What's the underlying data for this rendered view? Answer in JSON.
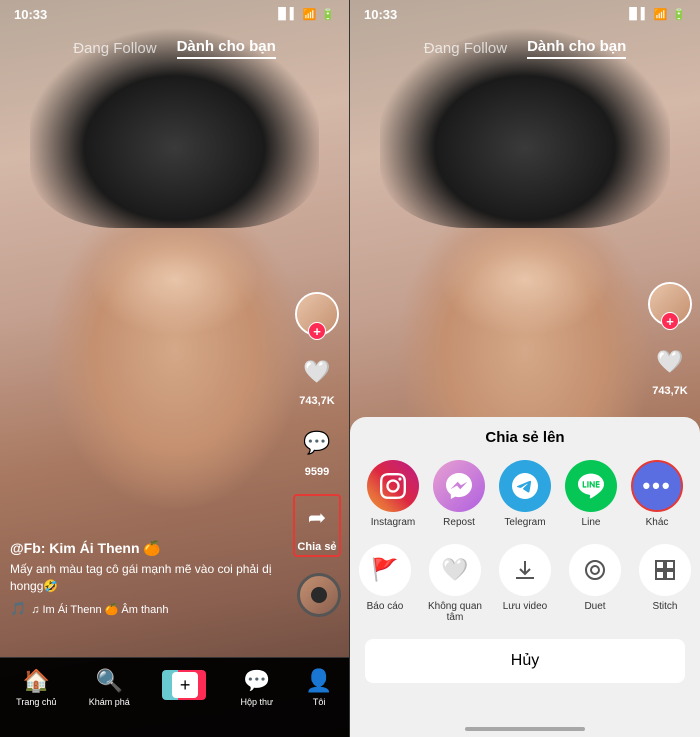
{
  "left_screen": {
    "status_time": "10:33",
    "nav": {
      "following": "Đang Follow",
      "for_you": "Dành cho bạn"
    },
    "sidebar": {
      "likes": "743,7K",
      "comments": "9599",
      "share_label": "Chia sẻ"
    },
    "content": {
      "username": "@Fb: Kim Ái Thenn 🍊",
      "caption": "Mấy anh màu tag cô gái mạnh mẽ vào coi phải dị hongg🤣",
      "music": "♫ Im Ái Thenn 🍊 Âm thanh"
    },
    "bottom_nav": [
      {
        "icon": "🏠",
        "label": "Trang chủ",
        "active": true
      },
      {
        "icon": "🔍",
        "label": "Khám phá",
        "active": false
      },
      {
        "icon": "+",
        "label": "",
        "active": false
      },
      {
        "icon": "💬",
        "label": "Hộp thư",
        "active": false
      },
      {
        "icon": "👤",
        "label": "Tôi",
        "active": false
      }
    ]
  },
  "right_screen": {
    "status_time": "10:33",
    "nav": {
      "following": "Đang Follow",
      "for_you": "Dành cho bạn"
    },
    "sidebar": {
      "likes": "743,7K"
    },
    "share_panel": {
      "title": "Chia sẻ lên",
      "share_options": [
        {
          "label": "Instagram",
          "type": "instagram"
        },
        {
          "label": "Repost",
          "type": "messenger"
        },
        {
          "label": "Telegram",
          "type": "telegram"
        },
        {
          "label": "Line",
          "type": "line"
        },
        {
          "label": "Khác",
          "type": "more",
          "highlighted": true
        }
      ],
      "action_options": [
        {
          "label": "Báo cáo",
          "icon": "🚩"
        },
        {
          "label": "Không quan tâm",
          "icon": "🤍"
        },
        {
          "label": "Lưu video",
          "icon": "⬇"
        },
        {
          "label": "Duet",
          "icon": "◎"
        },
        {
          "label": "Stitch",
          "icon": "⊞"
        }
      ],
      "cancel_label": "Hủy"
    }
  }
}
